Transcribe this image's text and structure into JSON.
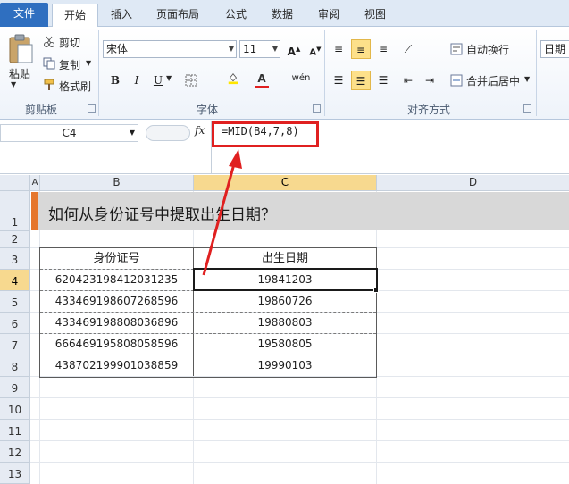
{
  "ribbon_tabs": [
    "文件",
    "开始",
    "插入",
    "页面布局",
    "公式",
    "数据",
    "审阅",
    "视图"
  ],
  "clipboard": {
    "paste": "粘贴",
    "cut": "剪切",
    "copy": "复制",
    "format_painter": "格式刷",
    "group_label": "剪贴板"
  },
  "font": {
    "family": "宋体",
    "size": "11",
    "group_label": "字体"
  },
  "alignment": {
    "wrap": "自动换行",
    "merge": "合并后居中",
    "group_label": "对齐方式"
  },
  "number": {
    "format": "日期"
  },
  "formula_bar": {
    "name_box": "C4",
    "fx": "fx",
    "formula": "=MID(B4,7,8)"
  },
  "columns": [
    "A",
    "B",
    "C",
    "D"
  ],
  "rows": [
    "1",
    "2",
    "3",
    "4",
    "5",
    "6",
    "7",
    "8",
    "9",
    "10",
    "11",
    "12",
    "13"
  ],
  "sheet": {
    "title": "如何从身份证号中提取出生日期？",
    "headers": [
      "身份证号",
      "出生日期"
    ],
    "data": [
      [
        "620423198412031235",
        "19841203"
      ],
      [
        "433469198607268596",
        "19860726"
      ],
      [
        "433469198808036896",
        "19880803"
      ],
      [
        "666469195808058596",
        "19580805"
      ],
      [
        "438702199901038859",
        "19990103"
      ]
    ]
  },
  "colors": {
    "accent": "#e5762c",
    "highlight": "#e02020",
    "file_tab": "#2f6fc0"
  }
}
